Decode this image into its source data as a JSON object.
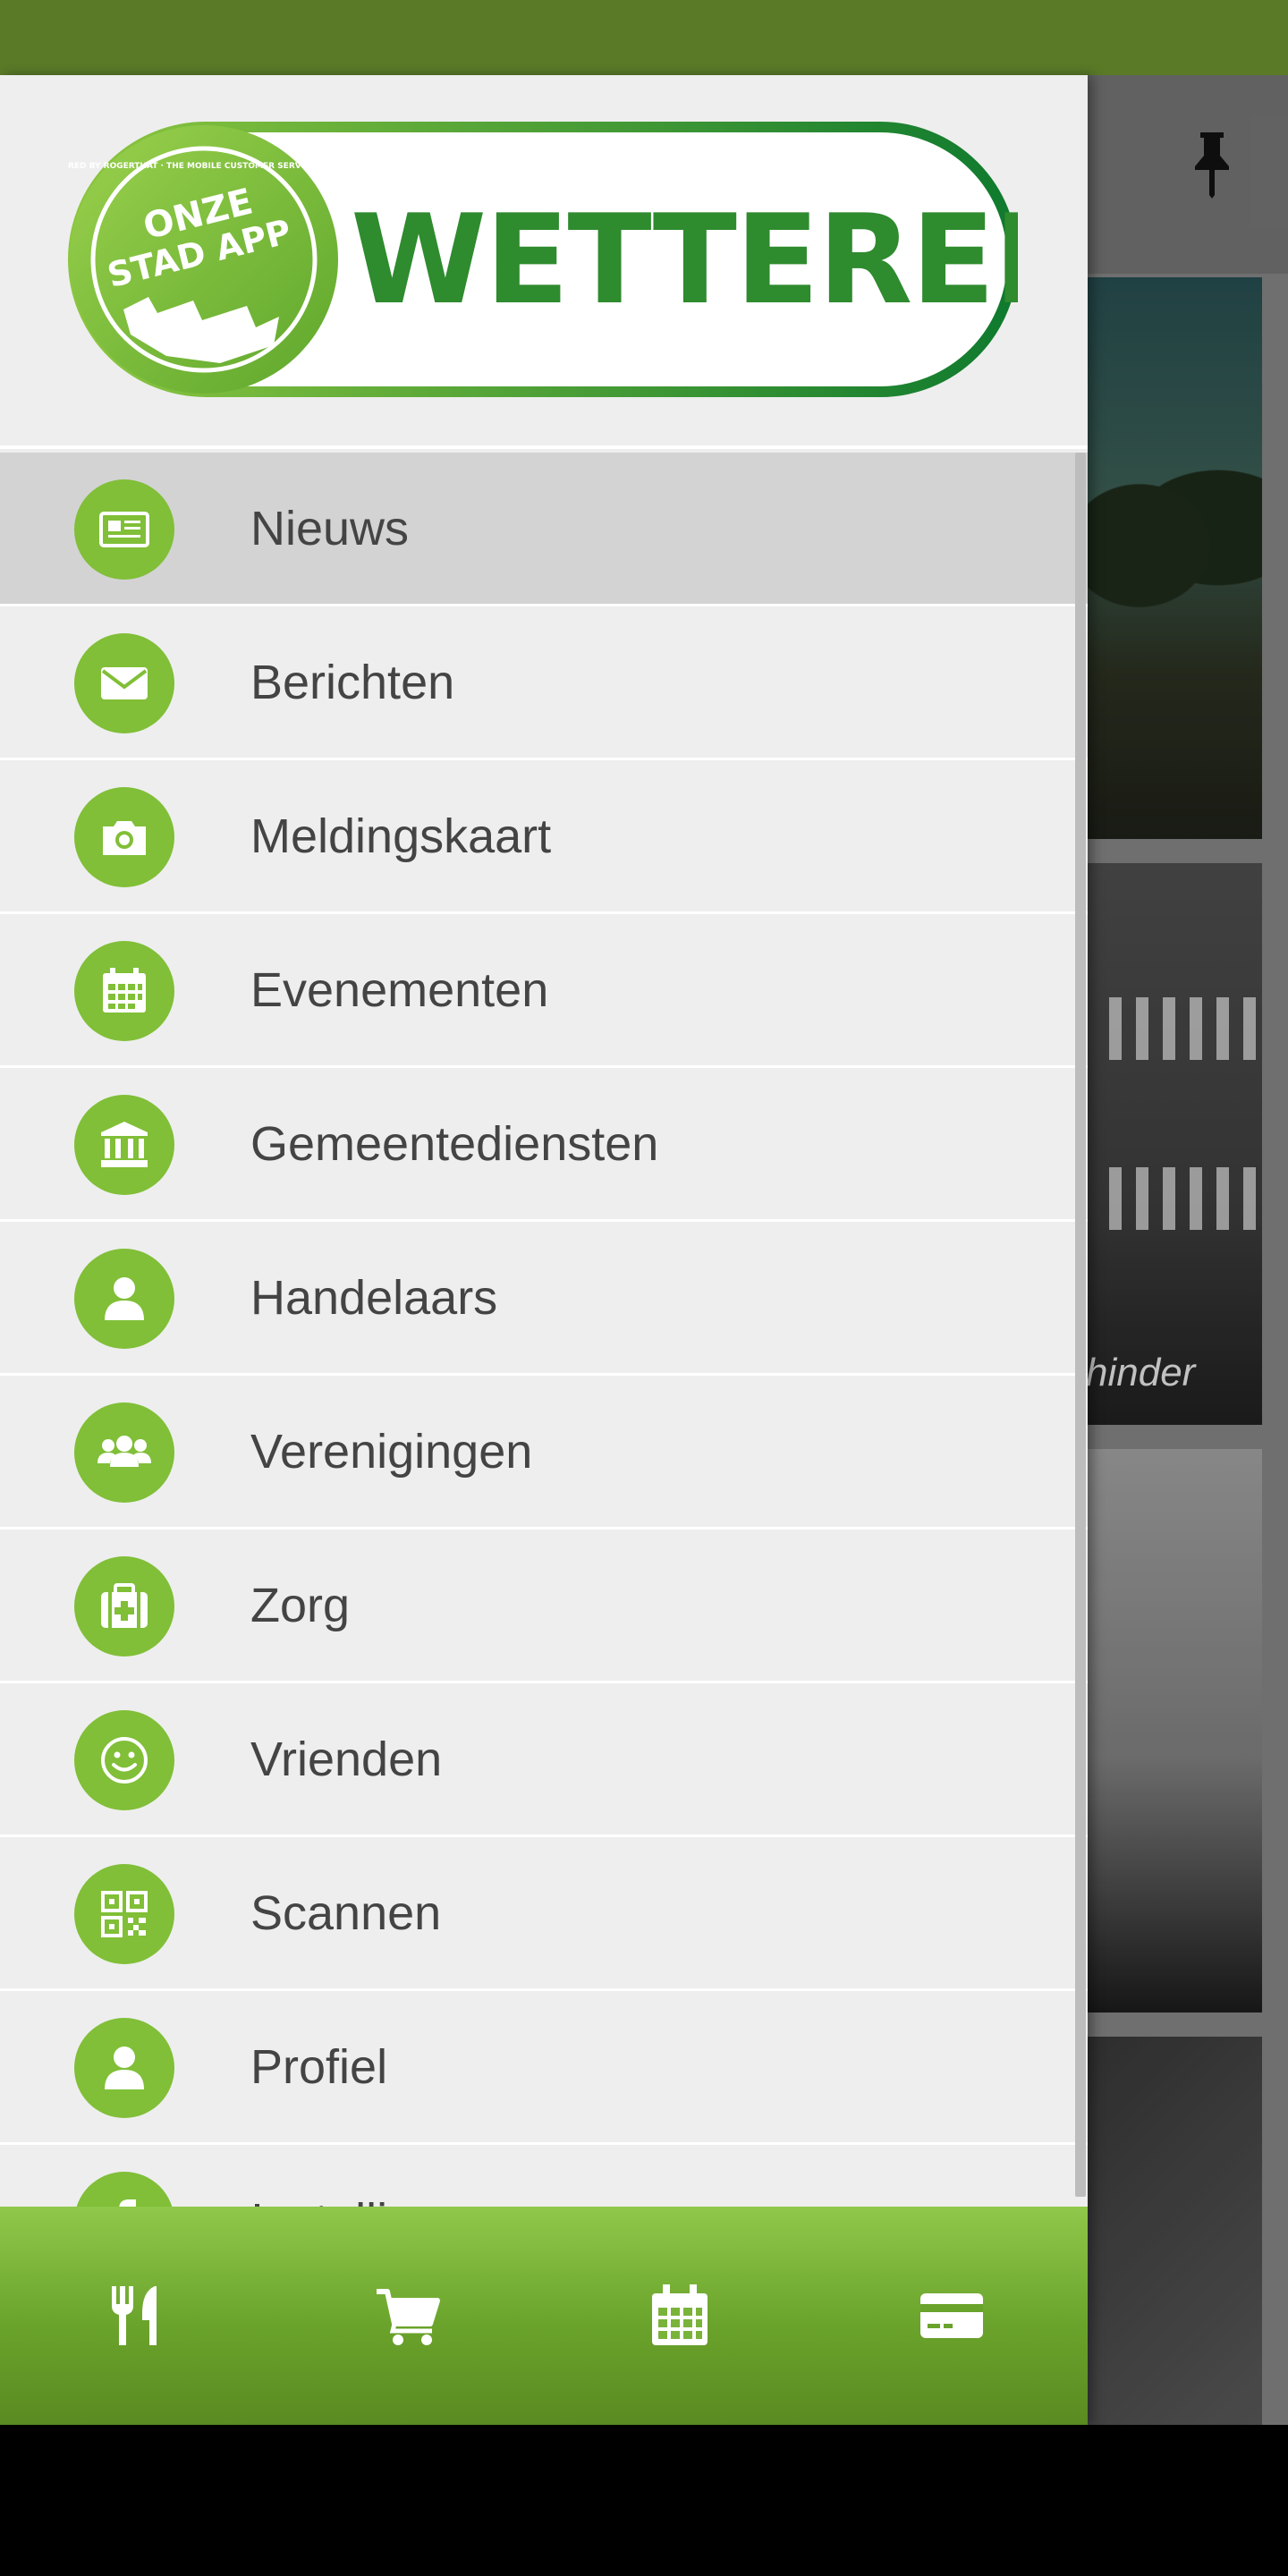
{
  "background_app": {
    "card_caption": "hinder"
  },
  "drawer": {
    "logo": {
      "badge_line1": "ONZE",
      "badge_line2": "STAD APP",
      "badge_ring_text": "POWERED BY ROGERTHAT · THE MOBILE CUSTOMER SERVICE PLATFORM",
      "city": "WETTEREN",
      "brand_color": "#2e8b2e",
      "badge_color": "#80bf37"
    },
    "menu_items": [
      {
        "label": "Nieuws",
        "icon": "newspaper-icon",
        "active": true
      },
      {
        "label": "Berichten",
        "icon": "envelope-icon"
      },
      {
        "label": "Meldingskaart",
        "icon": "camera-icon"
      },
      {
        "label": "Evenementen",
        "icon": "calendar-icon"
      },
      {
        "label": "Gemeentediensten",
        "icon": "institution-icon"
      },
      {
        "label": "Handelaars",
        "icon": "user-icon"
      },
      {
        "label": "Verenigingen",
        "icon": "users-icon"
      },
      {
        "label": "Zorg",
        "icon": "medkit-icon"
      },
      {
        "label": "Vrienden",
        "icon": "smile-icon"
      },
      {
        "label": "Scannen",
        "icon": "qrcode-icon"
      },
      {
        "label": "Profiel",
        "icon": "user-icon"
      },
      {
        "label": "Instellingen",
        "icon": "facebook-icon"
      }
    ],
    "accent_color": "#80bf37",
    "active_bg": "#d3d3d3"
  },
  "bottom_bar": {
    "buttons": [
      {
        "icon": "cutlery-icon"
      },
      {
        "icon": "shopping-cart-icon"
      },
      {
        "icon": "calendar-icon"
      },
      {
        "icon": "credit-card-icon"
      }
    ]
  }
}
